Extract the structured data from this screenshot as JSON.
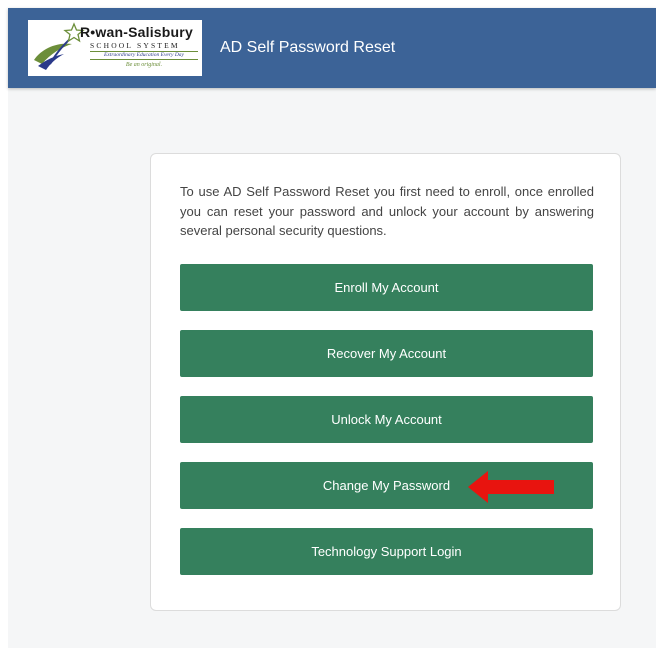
{
  "header": {
    "logo": {
      "name": "R•wan-Salisbury",
      "subtitle": "SCHOOL SYSTEM",
      "tagline": "Extraordinary Education Every Day",
      "motto": "Be an original."
    },
    "title": "AD Self Password Reset",
    "background_color": "#3c6397"
  },
  "card": {
    "intro_text": "To use AD Self Password Reset you first need to enroll, once enrolled you can reset your password and unlock your account by answering several personal security questions.",
    "buttons": [
      {
        "label": "Enroll My Account"
      },
      {
        "label": "Recover My Account"
      },
      {
        "label": "Unlock My Account"
      },
      {
        "label": "Change My Password"
      },
      {
        "label": "Technology Support Login"
      }
    ],
    "button_color": "#35805d"
  },
  "annotation": {
    "icon": "arrow-left-icon",
    "color": "#e8140f"
  }
}
